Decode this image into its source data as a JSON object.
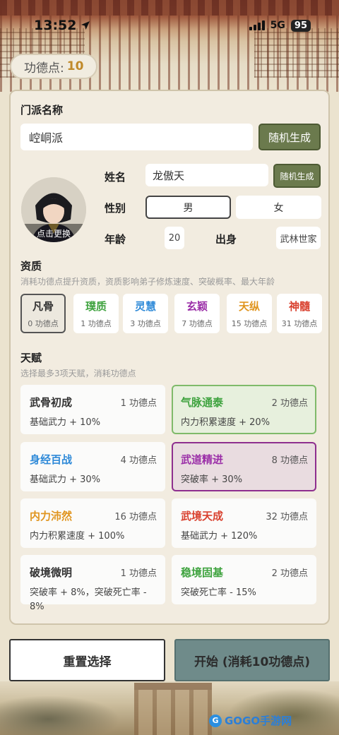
{
  "status": {
    "time": "13:52",
    "network": "5G",
    "battery": "95"
  },
  "merit": {
    "label": "功德点:",
    "value": "10"
  },
  "sect": {
    "label": "门派名称",
    "value": "崆峒派",
    "random_btn": "随机生成"
  },
  "avatar": {
    "hint": "点击更换"
  },
  "profile": {
    "name_label": "姓名",
    "name_value": "龙傲天",
    "name_random_btn": "随机生成",
    "gender_label": "性别",
    "gender_options": [
      "男",
      "女"
    ],
    "gender_selected": "男",
    "age_label": "年龄",
    "age_value": "20",
    "origin_label": "出身",
    "origin_value": "武林世家"
  },
  "aptitude": {
    "title": "资质",
    "hint": "消耗功德点提升资质，资质影响弟子修炼速度、突破概率、最大年龄",
    "selected": "凡骨",
    "items": [
      {
        "name": "凡骨",
        "cost": "0 功德点",
        "color": "#333333"
      },
      {
        "name": "璞质",
        "cost": "1 功德点",
        "color": "#3fa33f"
      },
      {
        "name": "灵慧",
        "cost": "3 功德点",
        "color": "#2f8ad8"
      },
      {
        "name": "玄颖",
        "cost": "7 功德点",
        "color": "#9b2fa8"
      },
      {
        "name": "天纵",
        "cost": "15 功德点",
        "color": "#e0951f"
      },
      {
        "name": "神髓",
        "cost": "31 功德点",
        "color": "#d9412f"
      }
    ]
  },
  "talent": {
    "title": "天赋",
    "hint": "选择最多3项天赋，消耗功德点",
    "items": [
      {
        "name": "武骨初成",
        "cost": "1 功德点",
        "desc": "基础武力 + 10%",
        "color": "#333333",
        "selected": false
      },
      {
        "name": "气脉通泰",
        "cost": "2 功德点",
        "desc": "内力积累速度 + 20%",
        "color": "#3fa33f",
        "selected": true
      },
      {
        "name": "身经百战",
        "cost": "4 功德点",
        "desc": "基础武力 + 30%",
        "color": "#2f8ad8",
        "selected": false
      },
      {
        "name": "武道精进",
        "cost": "8 功德点",
        "desc": "突破率 + 30%",
        "color": "#9b2fa8",
        "selected": true
      },
      {
        "name": "内力沛然",
        "cost": "16 功德点",
        "desc": "内力积累速度 + 100%",
        "color": "#e0951f",
        "selected": false
      },
      {
        "name": "武境天成",
        "cost": "32 功德点",
        "desc": "基础武力 + 120%",
        "color": "#d9412f",
        "selected": false
      },
      {
        "name": "破境微明",
        "cost": "1 功德点",
        "desc": "突破率 + 8%，突破死亡率 - 8%",
        "color": "#333333",
        "selected": false
      },
      {
        "name": "稳境固基",
        "cost": "2 功德点",
        "desc": "突破死亡率 - 15%",
        "color": "#3fa33f",
        "selected": false
      }
    ]
  },
  "actions": {
    "reset": "重置选择",
    "start": "开始 (消耗10功德点)"
  },
  "watermark": {
    "text": "GOGO手游网"
  }
}
